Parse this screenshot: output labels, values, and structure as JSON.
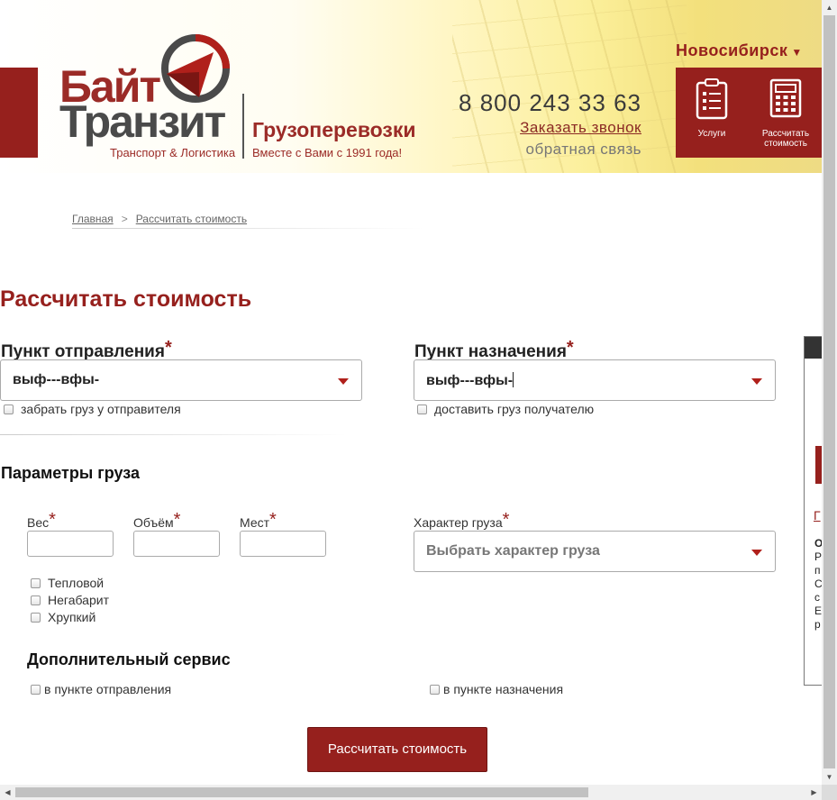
{
  "header": {
    "logo_line1": "Байт",
    "logo_line2": "Транзит",
    "logo_subtitle": "Транспорт & Логистика",
    "logo_tagline": "Грузоперевозки",
    "logo_tagline2": "Вместе с Вами с 1991 года!",
    "phone": "8 800 243 33 63",
    "callback_link": "Заказать звонок",
    "feedback_link": "обратная связь",
    "city": "Новосибирск",
    "tiles": [
      {
        "label": "Услуги",
        "icon": "checklist-icon"
      },
      {
        "label": "Рассчитать стоимость",
        "icon": "calculator-icon"
      }
    ],
    "brand_color": "#96201d"
  },
  "breadcrumb": {
    "home": "Главная",
    "separator": ">",
    "current": "Рассчитать стоимость"
  },
  "page_title": "Рассчитать стоимость",
  "route": {
    "origin_label": "Пункт отправления",
    "origin_value": "выф---вфы-",
    "origin_checkbox": "забрать груз у отправителя",
    "destination_label": "Пункт назначения",
    "destination_value": "выф---вфы-",
    "destination_checkbox": "доставить груз получателю",
    "required_mark": "*"
  },
  "cargo": {
    "section_title": "Параметры груза",
    "weight_label": "Вес",
    "volume_label": "Объём",
    "places_label": "Мест",
    "weight_value": "",
    "volume_value": "",
    "places_value": "",
    "type_label": "Характер груза",
    "type_placeholder": "Выбрать характер груза",
    "options": [
      "Тепловой",
      "Негабарит",
      "Хрупкий"
    ]
  },
  "extra_service": {
    "section_title": "Дополнительный сервис",
    "at_origin": "в пункте отправления",
    "at_destination": "в пункте назначения"
  },
  "submit_label": "Рассчитать стоимость",
  "side_widget": {
    "link_glyph": "Г",
    "text_lines": [
      "О",
      "Р",
      "п",
      "С",
      "с",
      "Е",
      "р"
    ]
  }
}
